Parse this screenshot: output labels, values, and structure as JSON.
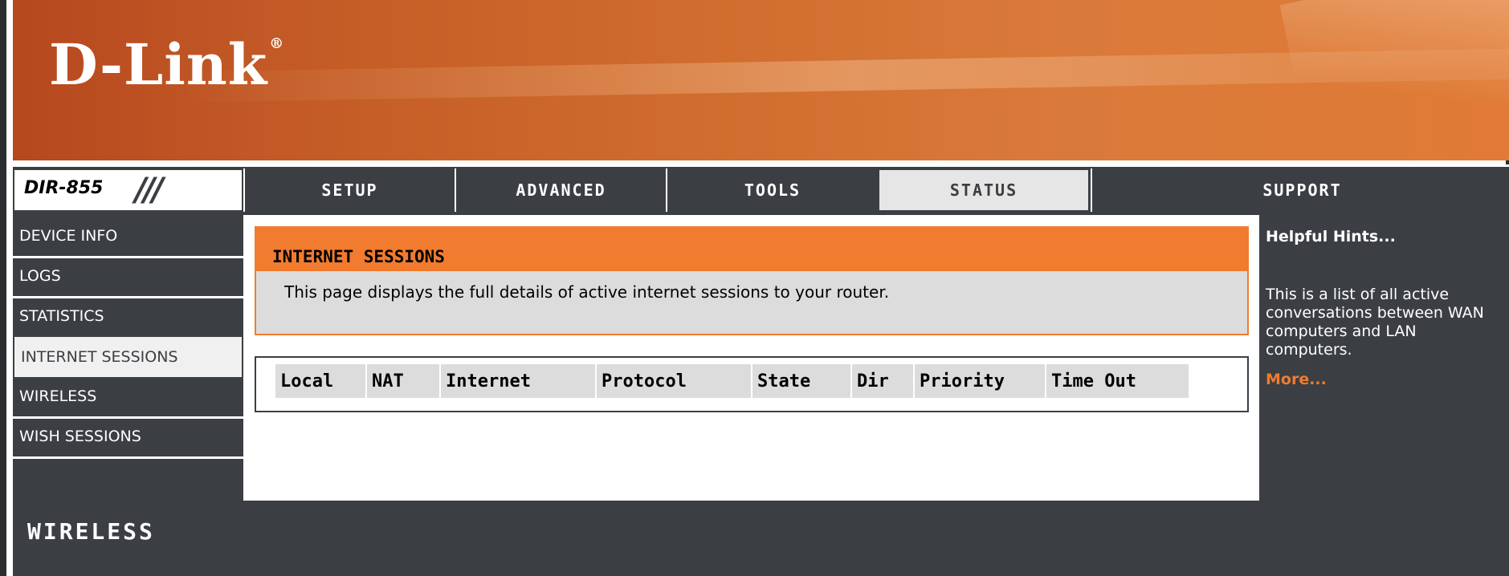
{
  "brand": {
    "logo": "D-Link",
    "registered_mark": "®"
  },
  "nav": {
    "model": "DIR-855",
    "model_decoration": "///",
    "tabs": [
      {
        "label": "SETUP",
        "active": false
      },
      {
        "label": "ADVANCED",
        "active": false
      },
      {
        "label": "TOOLS",
        "active": false
      },
      {
        "label": "STATUS",
        "active": true
      },
      {
        "label": "SUPPORT",
        "active": false
      }
    ]
  },
  "sidebar": {
    "items": [
      {
        "label": "DEVICE INFO",
        "active": false
      },
      {
        "label": "LOGS",
        "active": false
      },
      {
        "label": "STATISTICS",
        "active": false
      },
      {
        "label": "INTERNET SESSIONS",
        "active": true
      },
      {
        "label": "WIRELESS",
        "active": false
      },
      {
        "label": "WISH SESSIONS",
        "active": false
      }
    ]
  },
  "main": {
    "section_title": "INTERNET SESSIONS",
    "description": "This page displays the full details of active internet sessions to your router.",
    "table_headers": [
      "Local",
      "NAT",
      "Internet",
      "Protocol",
      "State",
      "Dir",
      "Priority",
      "Time Out"
    ]
  },
  "hints": {
    "title": "Helpful Hints...",
    "text": "This is a list of all active conversations between WAN computers and LAN computers.",
    "more_link": "More..."
  },
  "footer": {
    "label": "WIRELESS"
  },
  "colors": {
    "accent": "#f17b2e",
    "dark": "#3b3f43",
    "panel": "#dcdcdc"
  }
}
